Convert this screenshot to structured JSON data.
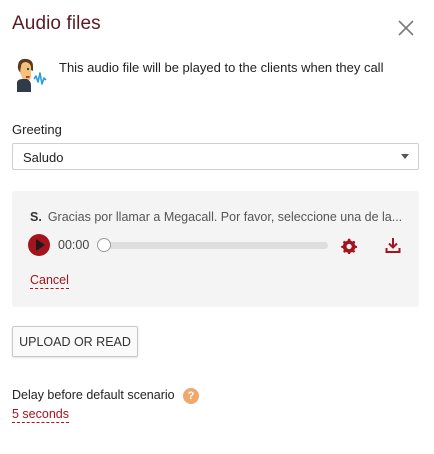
{
  "header": {
    "title": "Audio files",
    "close_icon": "close-icon"
  },
  "info": {
    "icon": "speaking-person-icon",
    "text": "This audio file will be played to the clients when they call"
  },
  "greeting": {
    "label": "Greeting",
    "selected": "Saludo"
  },
  "player": {
    "prefix": "S.",
    "track_text": "Gracias por llamar a Megacall. Por favor, seleccione una de la...",
    "time": "00:00",
    "progress_percent": 0,
    "play_icon": "play-icon",
    "settings_icon": "gear-icon",
    "download_icon": "download-icon",
    "cancel_label": "Cancel"
  },
  "actions": {
    "upload_label": "UPLOAD OR READ"
  },
  "delay": {
    "label": "Delay before default scenario",
    "help_icon": "question-icon",
    "help_glyph": "?",
    "value": "5 seconds"
  },
  "colors": {
    "accent": "#a5141c",
    "title": "#5a1b24",
    "help": "#f0a86d",
    "card_bg": "#f4f4f4"
  }
}
